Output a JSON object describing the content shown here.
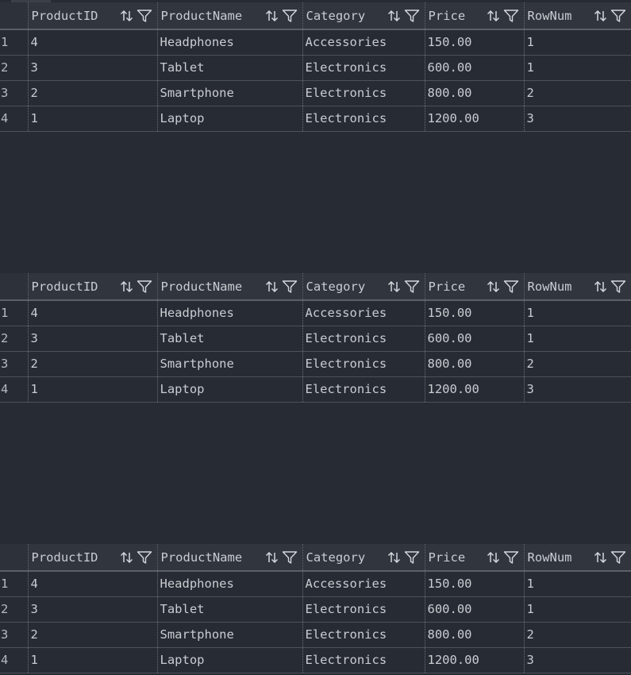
{
  "columns": [
    "ProductID",
    "ProductName",
    "Category",
    "Price",
    "RowNum"
  ],
  "icons": {
    "sort": "sort-arrows-icon",
    "filter": "filter-funnel-icon"
  },
  "grids": [
    {
      "rows": [
        {
          "num": "1",
          "cells": [
            "4",
            "Headphones",
            "Accessories",
            "150.00",
            "1"
          ]
        },
        {
          "num": "2",
          "cells": [
            "3",
            "Tablet",
            "Electronics",
            "600.00",
            "1"
          ]
        },
        {
          "num": "3",
          "cells": [
            "2",
            "Smartphone",
            "Electronics",
            "800.00",
            "2"
          ]
        },
        {
          "num": "4",
          "cells": [
            "1",
            "Laptop",
            "Electronics",
            "1200.00",
            "3"
          ]
        }
      ]
    },
    {
      "rows": [
        {
          "num": "1",
          "cells": [
            "4",
            "Headphones",
            "Accessories",
            "150.00",
            "1"
          ]
        },
        {
          "num": "2",
          "cells": [
            "3",
            "Tablet",
            "Electronics",
            "600.00",
            "1"
          ]
        },
        {
          "num": "3",
          "cells": [
            "2",
            "Smartphone",
            "Electronics",
            "800.00",
            "2"
          ]
        },
        {
          "num": "4",
          "cells": [
            "1",
            "Laptop",
            "Electronics",
            "1200.00",
            "3"
          ]
        }
      ]
    },
    {
      "rows": [
        {
          "num": "1",
          "cells": [
            "4",
            "Headphones",
            "Accessories",
            "150.00",
            "1"
          ]
        },
        {
          "num": "2",
          "cells": [
            "3",
            "Tablet",
            "Electronics",
            "600.00",
            "1"
          ]
        },
        {
          "num": "3",
          "cells": [
            "2",
            "Smartphone",
            "Electronics",
            "800.00",
            "2"
          ]
        },
        {
          "num": "4",
          "cells": [
            "1",
            "Laptop",
            "Electronics",
            "1200.00",
            "3"
          ]
        }
      ]
    }
  ]
}
